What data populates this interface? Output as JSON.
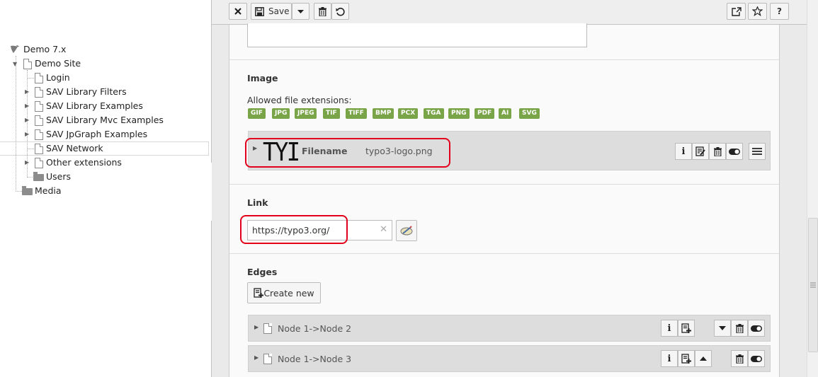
{
  "tree": {
    "root": {
      "label": "Demo 7.x",
      "icon": "typo3-logo-icon"
    },
    "items": [
      {
        "label": "Demo Site",
        "icon": "page-icon",
        "expanded": true
      },
      {
        "label": "Login",
        "icon": "page-icon"
      },
      {
        "label": "SAV Library Filters",
        "icon": "page-icon",
        "collapsed": true
      },
      {
        "label": "SAV Library Examples",
        "icon": "page-icon",
        "collapsed": true
      },
      {
        "label": "SAV Library Mvc Examples",
        "icon": "page-icon",
        "collapsed": true
      },
      {
        "label": "SAV JpGraph Examples",
        "icon": "page-icon",
        "collapsed": true
      },
      {
        "label": "SAV Network",
        "icon": "page-icon",
        "selected": true
      },
      {
        "label": "Other extensions",
        "icon": "page-icon",
        "collapsed": true
      },
      {
        "label": "Users",
        "icon": "folder-icon"
      },
      {
        "label": "Media",
        "icon": "folder-icon"
      }
    ]
  },
  "toolbar": {
    "close_icon": "close-icon",
    "save_label": "Save",
    "save_icon": "floppy-disk-icon",
    "dropdown_icon": "caret-down-icon",
    "delete_icon": "trash-icon",
    "undo_icon": "undo-icon",
    "open_new_window_icon": "external-link-icon",
    "bookmark_icon": "star-icon",
    "help_label": "?"
  },
  "image_field": {
    "label": "Image",
    "allowed_label": "Allowed file extensions:",
    "extensions": [
      "GIF",
      "JPG",
      "JPEG",
      "TIF",
      "TIFF",
      "BMP",
      "PCX",
      "TGA",
      "PNG",
      "PDF",
      "AI",
      "SVG"
    ],
    "file": {
      "thumb_text": "TYI",
      "filename_label": "Filename",
      "filename_value": "typo3-logo.png",
      "actions": [
        "info-icon",
        "edit-metadata-icon",
        "trash-icon",
        "toggle-icon",
        "drag-handle-icon"
      ]
    }
  },
  "link_field": {
    "label": "Link",
    "value": "https://typo3.org/",
    "clear_icon": "clear-icon",
    "wizard_icon": "link-wizard-icon"
  },
  "edges_field": {
    "label": "Edges",
    "create_label": "Create new",
    "records": [
      {
        "title": "Node 1->Node 2"
      },
      {
        "title": "Node 1->Node 3"
      }
    ]
  },
  "colors": {
    "badge_green": "#79a548",
    "highlight_red": "#e2001a",
    "typo3_orange": "#7a7a7a"
  }
}
